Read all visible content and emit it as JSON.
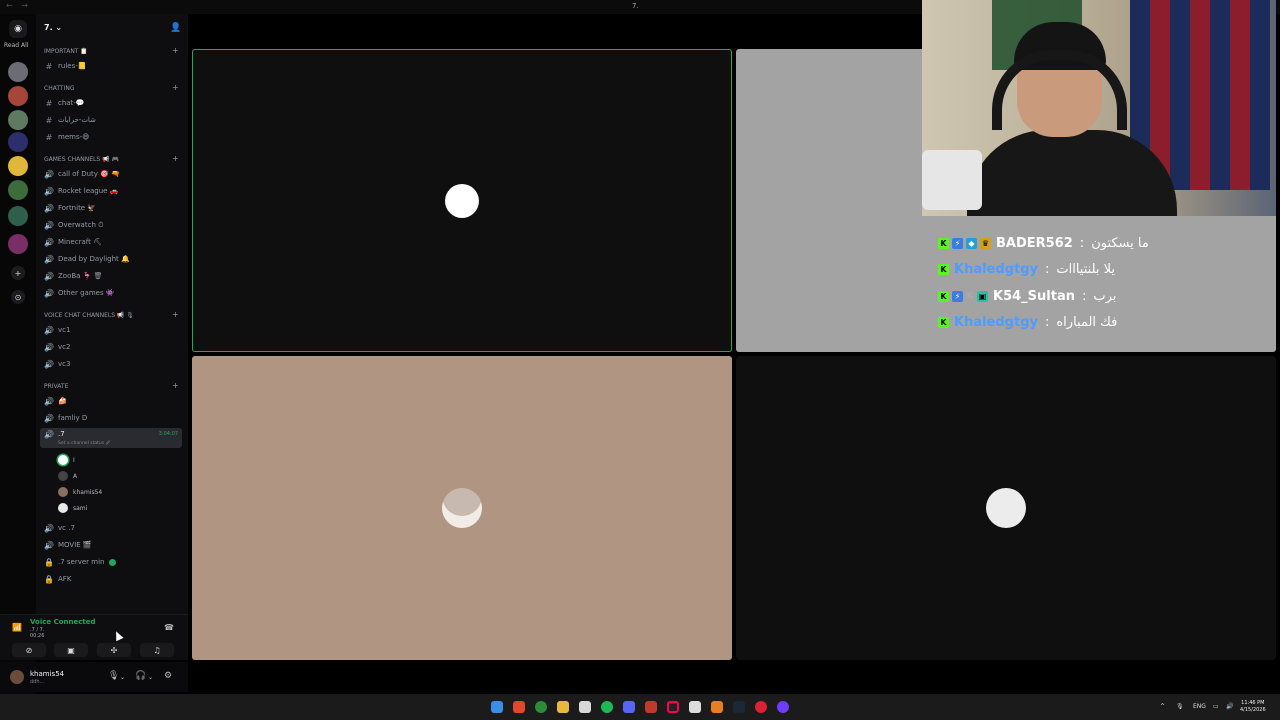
{
  "window": {
    "title": "7."
  },
  "rail": {
    "read_all": "Read All"
  },
  "server": {
    "name": "7.",
    "categories": [
      {
        "name": "IMPORTANT 📋"
      },
      {
        "name": "CHATTING"
      },
      {
        "name": "Games channels 📢 🎮"
      },
      {
        "name": "Voice Chat Channels 📢 🎙"
      },
      {
        "name": "PRIVATE"
      }
    ],
    "channels": {
      "rules": "rules-📒",
      "chat": "chat-💬",
      "chat_ar": "شات-حرايات",
      "mems": "mems-😄",
      "cod": "call of Duty 🎯 🔫",
      "rocket": "Rocket league 🚗",
      "fortnite": "Fortnite 🦅",
      "overwatch": "Overwatch ⏱",
      "minecraft": "Minecraft ⛏",
      "dbd": "Dead by Daylight 🔔",
      "zooba": "ZooBa 🦩 🗑",
      "other": "Other games 👾",
      "vc1": "vc1",
      "vc2": "vc2",
      "vc3": "vc3",
      "private_1": "🍰",
      "family": "famliy D",
      "active": ".7",
      "active_timer": "3:04:07",
      "active_status": "Set a channel status 🖉",
      "vc7": "vc .7",
      "movie": "MOVIE 🎬",
      "server_min": ".7 server min",
      "afk": "AFK"
    },
    "voice_users": [
      "I",
      "A",
      "khamis54",
      "sami"
    ]
  },
  "voice_connected": {
    "title": "Voice Connected",
    "channel": ".7 / 7.",
    "time": "00:26"
  },
  "user": {
    "name": "khamis54",
    "status": "ddh..."
  },
  "overlay_chat": [
    {
      "badges": [
        "kick",
        "blue",
        "cube",
        "crown"
      ],
      "user": "BADER562",
      "user_color": "yellow",
      "msg": "ما يسكتون"
    },
    {
      "badges": [
        "kick"
      ],
      "user": "Khaledgtgy",
      "user_color": "blue",
      "msg": "يلا بلنتيااات"
    },
    {
      "badges": [
        "kick",
        "blue",
        "k",
        "og"
      ],
      "user": "K54_Sultan",
      "user_color": "yellow",
      "msg": "برب"
    },
    {
      "badges": [
        "kick"
      ],
      "user": "Khaledgtgy",
      "user_color": "blue",
      "msg": "فك المباراه"
    }
  ],
  "taskbar": {
    "lang": "ENG",
    "time": "11:46 PM",
    "date": "4/15/2026"
  },
  "colors": {
    "accent_green": "#23a55a",
    "tile_beige": "#b09682",
    "tile_grey": "#a3a3a3",
    "tile_dark": "#0f0f0f",
    "kick_green": "#53fc18"
  }
}
